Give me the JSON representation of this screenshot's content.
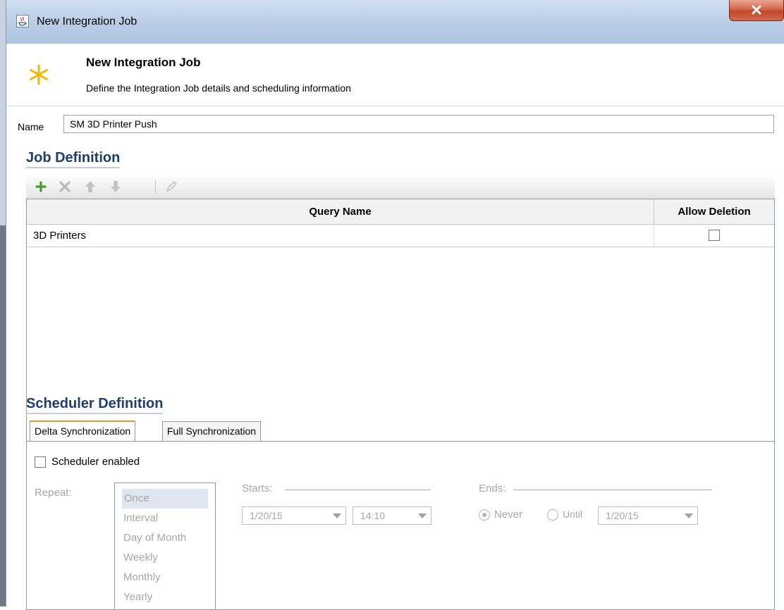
{
  "window": {
    "title": "New Integration Job",
    "close_label": "X"
  },
  "header": {
    "title": "New Integration Job",
    "subtitle": "Define the Integration Job details and scheduling information",
    "icon": "asterisk-new-icon",
    "accent": "#f2b705"
  },
  "name_field": {
    "label": "Name",
    "value": "SM 3D Printer Push"
  },
  "job_definition": {
    "title": "Job Definition",
    "toolbar": [
      "add-icon",
      "delete-icon",
      "move-up-icon",
      "move-down-icon",
      "edit-icon"
    ],
    "columns": [
      "Query Name",
      "Allow Deletion"
    ],
    "rows": [
      {
        "query_name": "3D Printers",
        "allow_deletion": false
      }
    ]
  },
  "scheduler_definition": {
    "title": "Scheduler Definition",
    "tabs": [
      "Delta Synchronization",
      "Full Synchronization"
    ],
    "active_tab": "Delta Synchronization",
    "scheduler_enabled_label": "Scheduler enabled",
    "scheduler_enabled": false,
    "repeat_label": "Repeat:",
    "repeat_options": [
      "Once",
      "Interval",
      "Day of Month",
      "Weekly",
      "Monthly",
      "Yearly"
    ],
    "repeat_selected": "Once",
    "starts_label": "Starts:",
    "start_date": "1/20/15",
    "start_time": "14:10",
    "ends_label": "Ends:",
    "never_label": "Never",
    "until_label": "Until",
    "end_date": "1/20/15"
  }
}
